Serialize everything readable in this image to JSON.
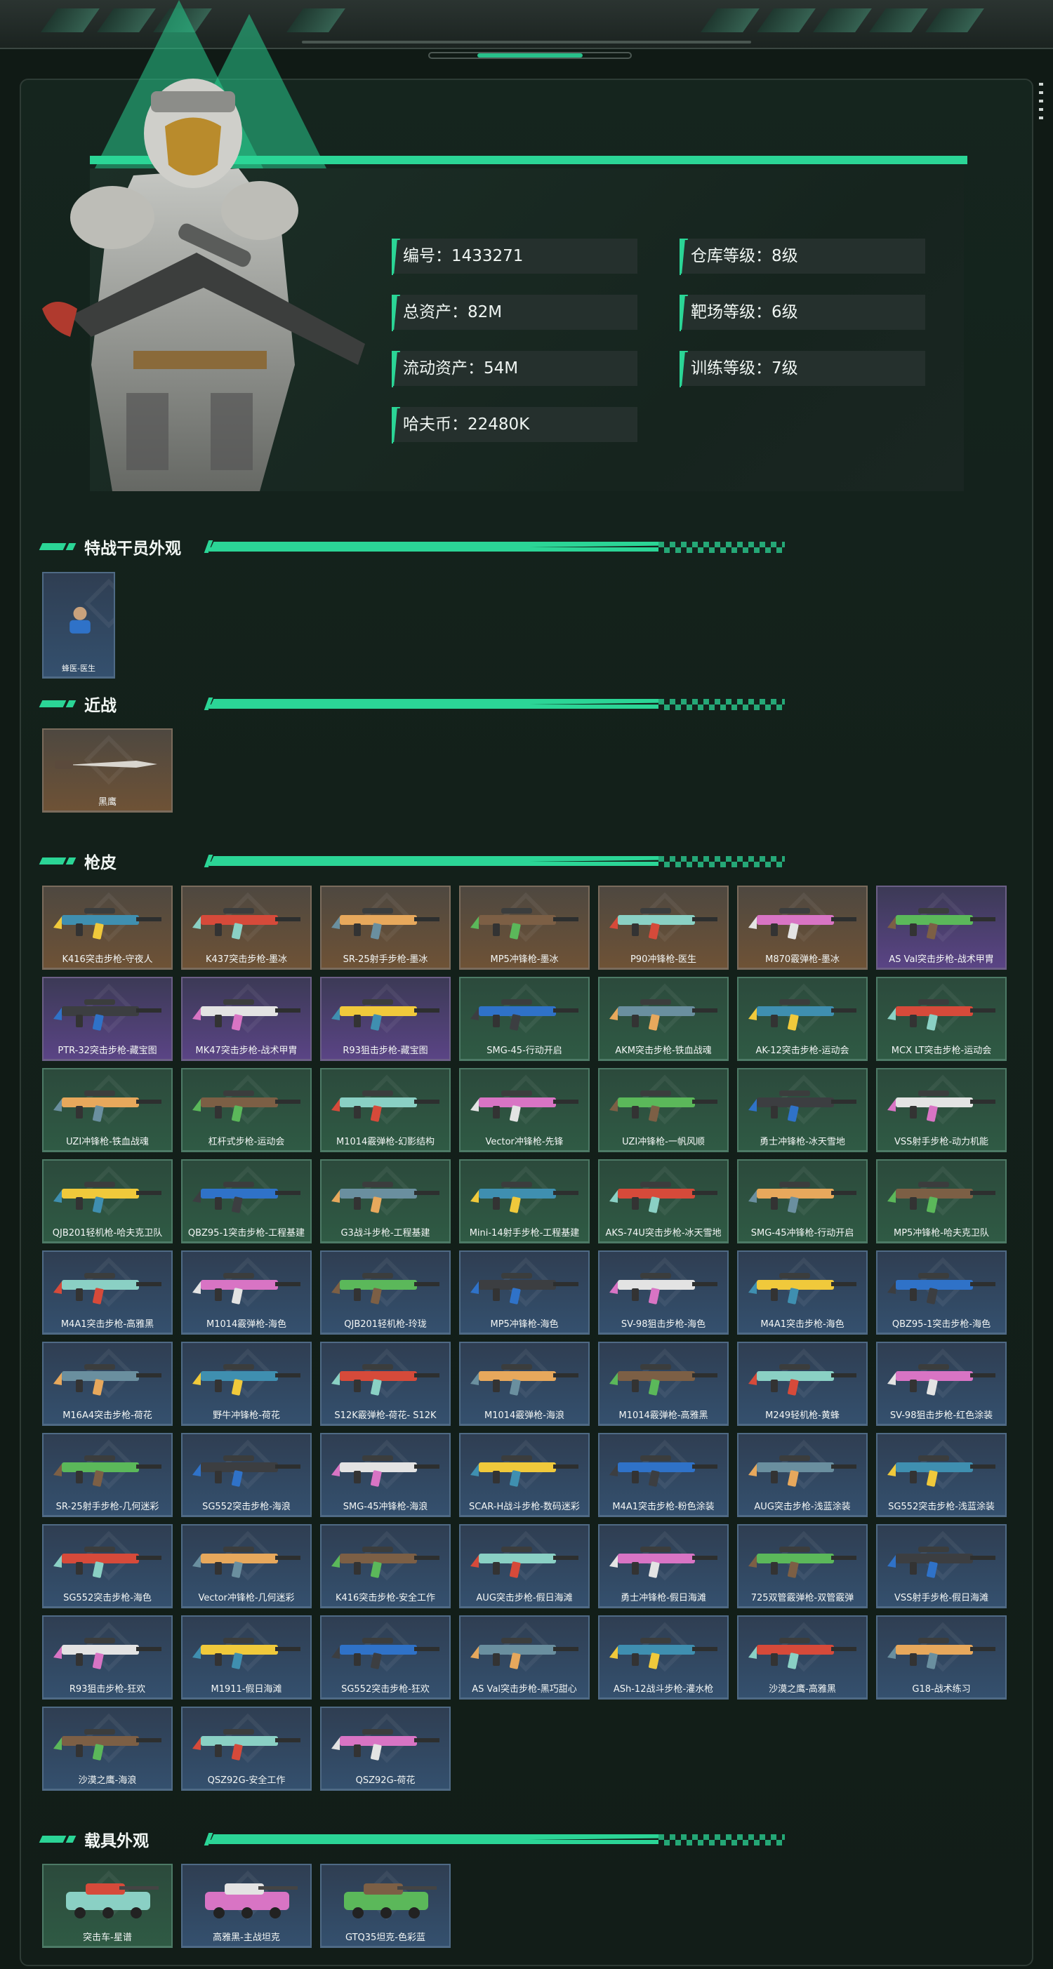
{
  "stats": {
    "id": "编号：1433271",
    "total_assets": "总资产：82M",
    "liquid_assets": "流动资产：54M",
    "havoc_coins": "哈夫币：22480K",
    "warehouse_level": "仓库等级：8级",
    "range_level": "靶场等级：6级",
    "training_level": "训练等级：7级"
  },
  "sections": {
    "operator": "特战干员外观",
    "melee": "近战",
    "skins": "枪皮",
    "vehicles": "载具外观"
  },
  "operator_items": [
    {
      "label": "蜂医-医生",
      "rarity": "blue"
    }
  ],
  "melee_items": [
    {
      "label": "黑鹰",
      "rarity": "orange"
    }
  ],
  "skin_items": [
    {
      "label": "K416突击步枪-守夜人",
      "rarity": "orange"
    },
    {
      "label": "K437突击步枪-墨冰",
      "rarity": "orange"
    },
    {
      "label": "SR-25射手步枪-墨冰",
      "rarity": "orange"
    },
    {
      "label": "MP5冲锋枪-墨冰",
      "rarity": "orange"
    },
    {
      "label": "P90冲锋枪-医生",
      "rarity": "orange"
    },
    {
      "label": "M870霰弹枪-墨冰",
      "rarity": "orange"
    },
    {
      "label": "AS Val突击步枪-战术甲胄",
      "rarity": "purple"
    },
    {
      "label": "PTR-32突击步枪-藏宝图",
      "rarity": "purple"
    },
    {
      "label": "MK47突击步枪-战术甲胄",
      "rarity": "purple"
    },
    {
      "label": "R93狙击步枪-藏宝图",
      "rarity": "purple"
    },
    {
      "label": "SMG-45-行动开启",
      "rarity": "green"
    },
    {
      "label": "AKM突击步枪-铁血战魂",
      "rarity": "green"
    },
    {
      "label": "AK-12突击步枪-运动会",
      "rarity": "green"
    },
    {
      "label": "MCX LT突击步枪-运动会",
      "rarity": "green"
    },
    {
      "label": "UZI冲锋枪-铁血战魂",
      "rarity": "green"
    },
    {
      "label": "杠杆式步枪-运动会",
      "rarity": "green"
    },
    {
      "label": "M1014霰弹枪-幻影结构",
      "rarity": "green"
    },
    {
      "label": "Vector冲锋枪-先锋",
      "rarity": "green"
    },
    {
      "label": "UZI冲锋枪-一帆风顺",
      "rarity": "green"
    },
    {
      "label": "勇士冲锋枪-冰天雪地",
      "rarity": "green"
    },
    {
      "label": "VSS射手步枪-动力机能",
      "rarity": "green"
    },
    {
      "label": "QJB201轻机枪-哈夫克卫队",
      "rarity": "green"
    },
    {
      "label": "QBZ95-1突击步枪-工程基建",
      "rarity": "green"
    },
    {
      "label": "G3战斗步枪-工程基建",
      "rarity": "green"
    },
    {
      "label": "Mini-14射手步枪-工程基建",
      "rarity": "green"
    },
    {
      "label": "AKS-74U突击步枪-冰天雪地",
      "rarity": "green"
    },
    {
      "label": "SMG-45冲锋枪-行动开启",
      "rarity": "green"
    },
    {
      "label": "MP5冲锋枪-哈夫克卫队",
      "rarity": "green"
    },
    {
      "label": "M4A1突击步枪-高雅黑",
      "rarity": "blue"
    },
    {
      "label": "M1014霰弹枪-海色",
      "rarity": "blue"
    },
    {
      "label": "QJB201轻机枪-玲珑",
      "rarity": "blue"
    },
    {
      "label": "MP5冲锋枪-海色",
      "rarity": "blue"
    },
    {
      "label": "SV-98狙击步枪-海色",
      "rarity": "blue"
    },
    {
      "label": "M4A1突击步枪-海色",
      "rarity": "blue"
    },
    {
      "label": "QBZ95-1突击步枪-海色",
      "rarity": "blue"
    },
    {
      "label": "M16A4突击步枪-荷花",
      "rarity": "blue"
    },
    {
      "label": "野牛冲锋枪-荷花",
      "rarity": "blue"
    },
    {
      "label": "S12K霰弹枪-荷花- S12K",
      "rarity": "blue"
    },
    {
      "label": "M1014霰弹枪-海浪",
      "rarity": "blue"
    },
    {
      "label": "M1014霰弹枪-高雅黑",
      "rarity": "blue"
    },
    {
      "label": "M249轻机枪-黄蜂",
      "rarity": "blue"
    },
    {
      "label": "SV-98狙击步枪-红色涂装",
      "rarity": "blue"
    },
    {
      "label": "SR-25射手步枪-几何迷彩",
      "rarity": "blue"
    },
    {
      "label": "SG552突击步枪-海浪",
      "rarity": "blue"
    },
    {
      "label": "SMG-45冲锋枪-海浪",
      "rarity": "blue"
    },
    {
      "label": "SCAR-H战斗步枪-数码迷彩",
      "rarity": "blue"
    },
    {
      "label": "M4A1突击步枪-粉色涂装",
      "rarity": "blue"
    },
    {
      "label": "AUG突击步枪-浅蓝涂装",
      "rarity": "blue"
    },
    {
      "label": "SG552突击步枪-浅蓝涂装",
      "rarity": "blue"
    },
    {
      "label": "SG552突击步枪-海色",
      "rarity": "blue"
    },
    {
      "label": "Vector冲锋枪-几何迷彩",
      "rarity": "blue"
    },
    {
      "label": "K416突击步枪-安全工作",
      "rarity": "blue"
    },
    {
      "label": "AUG突击步枪-假日海滩",
      "rarity": "blue"
    },
    {
      "label": "勇士冲锋枪-假日海滩",
      "rarity": "blue"
    },
    {
      "label": "725双管霰弹枪-双管霰弹",
      "rarity": "blue"
    },
    {
      "label": "VSS射手步枪-假日海滩",
      "rarity": "blue"
    },
    {
      "label": "R93狙击步枪-狂欢",
      "rarity": "blue"
    },
    {
      "label": "M1911-假日海滩",
      "rarity": "blue"
    },
    {
      "label": "SG552突击步枪-狂欢",
      "rarity": "blue"
    },
    {
      "label": "AS Val突击步枪-黑巧甜心",
      "rarity": "blue"
    },
    {
      "label": "ASh-12战斗步枪-灌水枪",
      "rarity": "blue"
    },
    {
      "label": "沙漠之鹰-高雅黑",
      "rarity": "blue"
    },
    {
      "label": "G18-战术练习",
      "rarity": "blue"
    },
    {
      "label": "沙漠之鹰-海浪",
      "rarity": "blue"
    },
    {
      "label": "QSZ92G-安全工作",
      "rarity": "blue"
    },
    {
      "label": "QSZ92G-荷花",
      "rarity": "blue"
    }
  ],
  "vehicle_items": [
    {
      "label": "突击车-星谱",
      "rarity": "green"
    },
    {
      "label": "高雅黑-主战坦克",
      "rarity": "blue"
    },
    {
      "label": "GTQ35坦克-色彩蓝",
      "rarity": "blue"
    }
  ],
  "colors": {
    "accent": "#2bd596",
    "orange": "#d9792c",
    "purple": "#a06ae0",
    "green": "#38c98a",
    "blue": "#4aa6e8"
  }
}
